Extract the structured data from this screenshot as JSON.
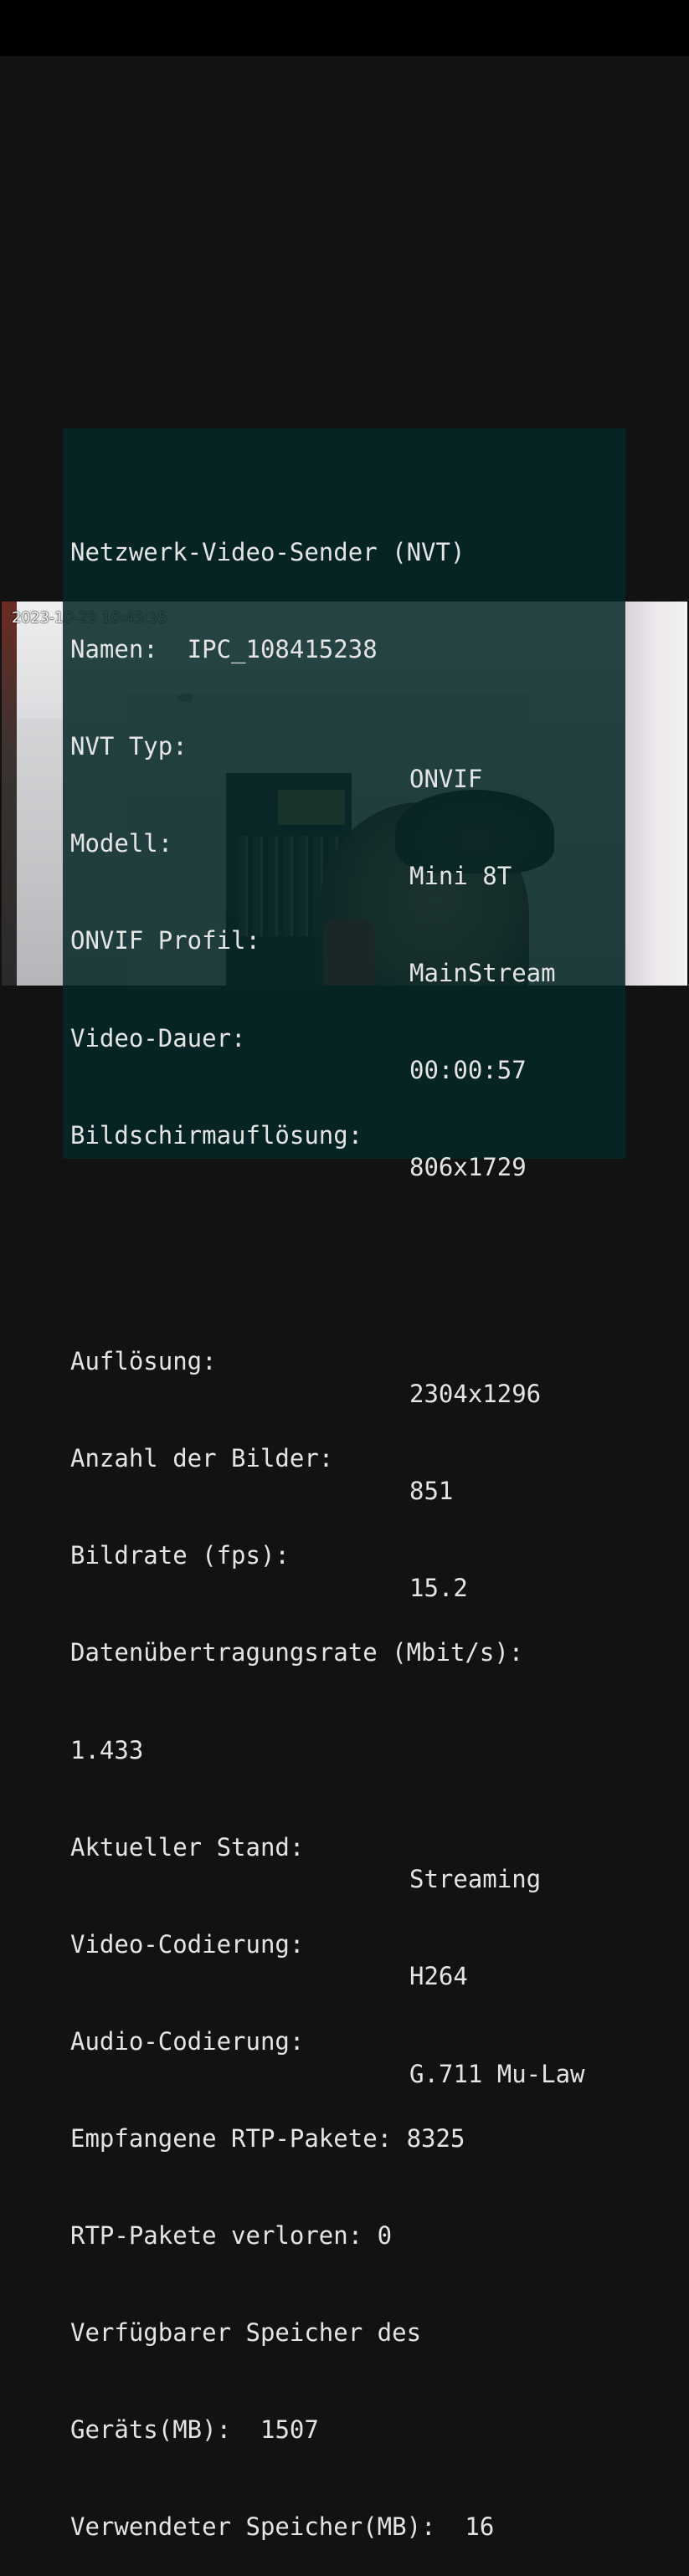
{
  "video": {
    "timestamp": "2023-10-29 10:45:35"
  },
  "info_panel": {
    "title": "Netzwerk-Video-Sender (NVT)",
    "name_line": "Namen:  IPC_108415238",
    "nvt_type": {
      "label": "NVT Typ:",
      "value": "ONVIF"
    },
    "model": {
      "label": "Modell:",
      "value": "Mini 8T"
    },
    "onvif_profile": {
      "label": "ONVIF Profil:",
      "value": "MainStream"
    },
    "video_duration": {
      "label": "Video-Dauer:",
      "value": "00:00:57"
    },
    "screen_resolution": {
      "label": "Bildschirmauflösung:",
      "value": "806x1729"
    },
    "resolution": {
      "label": "Auflösung:",
      "value": "2304x1296"
    },
    "frame_count": {
      "label": "Anzahl der Bilder:",
      "value": "851"
    },
    "frame_rate": {
      "label": "Bildrate (fps):",
      "value": "15.2"
    },
    "bitrate": {
      "label": "Datenübertragungsrate (Mbit/s):",
      "value": "1.433"
    },
    "current_status": {
      "label": "Aktueller Stand:",
      "value": "Streaming"
    },
    "video_codec": {
      "label": "Video-Codierung:",
      "value": "H264"
    },
    "audio_codec": {
      "label": "Audio-Codierung:",
      "value": "G.711 Mu-Law"
    },
    "rtp_received": {
      "label": "Empfangene RTP-Pakete:",
      "value": "8325"
    },
    "rtp_lost": {
      "label": "RTP-Pakete verloren:",
      "value": "0"
    },
    "free_storage": {
      "label_line1": "Verfügbarer Speicher des",
      "label_line2": "Geräts(MB):",
      "value": "1507"
    },
    "used_storage": {
      "label": "Verwendeter Speicher(MB):",
      "value": "16"
    }
  }
}
